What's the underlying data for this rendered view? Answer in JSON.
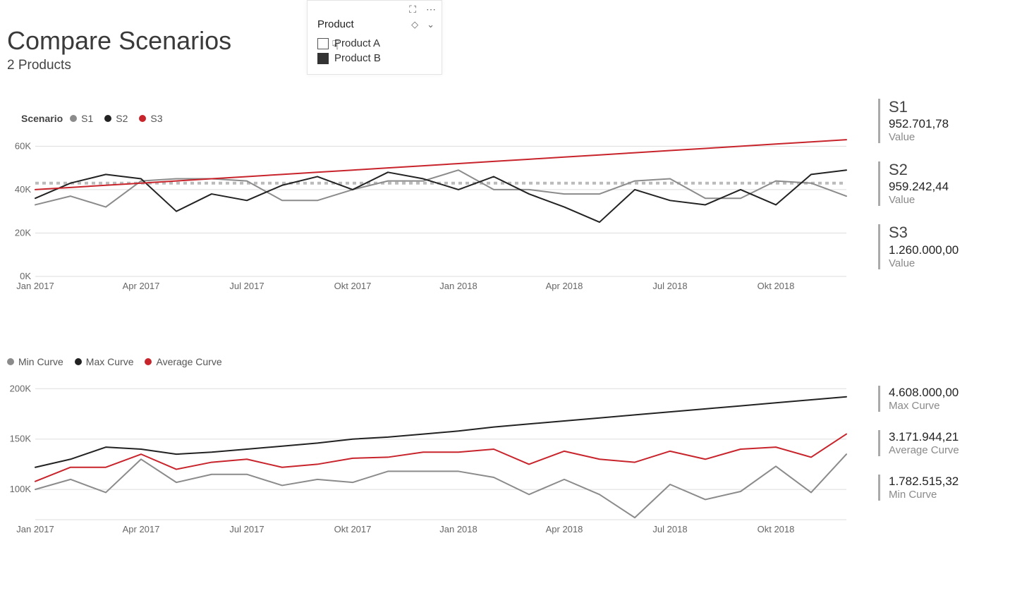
{
  "header": {
    "title": "Compare Scenarios",
    "subtitle": "2 Products"
  },
  "slicer": {
    "title": "Product",
    "items": [
      {
        "label": "Product A",
        "checked": false
      },
      {
        "label": "Product B",
        "checked": true
      }
    ],
    "icons": {
      "grip": "grip",
      "focus": "focus-mode-icon",
      "more": "⋯",
      "clear": "⌫",
      "dropdown": "⌄"
    }
  },
  "chart1": {
    "legend_label": "Scenario",
    "legend": [
      "S1",
      "S2",
      "S3"
    ],
    "xticks": [
      "Jan 2017",
      "Apr 2017",
      "Jul 2017",
      "Okt 2017",
      "Jan 2018",
      "Apr 2018",
      "Jul 2018",
      "Okt 2018"
    ],
    "yticks": [
      "0K",
      "20K",
      "40K",
      "60K"
    ],
    "ymin": 0,
    "ymax": 65,
    "avg_line": 43
  },
  "kpis1": [
    {
      "title": "S1",
      "value": "952.701,78",
      "sub": "Value"
    },
    {
      "title": "S2",
      "value": "959.242,44",
      "sub": "Value"
    },
    {
      "title": "S3",
      "value": "1.260.000,00",
      "sub": "Value"
    }
  ],
  "chart2": {
    "legend": [
      "Min Curve",
      "Max Curve",
      "Average Curve"
    ],
    "xticks": [
      "Jan 2017",
      "Apr 2017",
      "Jul 2017",
      "Okt 2017",
      "Jan 2018",
      "Apr 2018",
      "Jul 2018",
      "Okt 2018"
    ],
    "yticks": [
      "100K",
      "150K",
      "200K"
    ],
    "ymin": 70,
    "ymax": 210
  },
  "kpis2": [
    {
      "title": "",
      "value": "4.608.000,00",
      "sub": "Max Curve"
    },
    {
      "title": "",
      "value": "3.171.944,21",
      "sub": "Average Curve"
    },
    {
      "title": "",
      "value": "1.782.515,32",
      "sub": "Min Curve"
    }
  ],
  "chart_data": [
    {
      "type": "line",
      "title": "Scenario comparison",
      "xlabel": "",
      "ylabel": "",
      "ylim": [
        0,
        65000
      ],
      "average_reference": 43000,
      "x": [
        "2017-01",
        "2017-02",
        "2017-03",
        "2017-04",
        "2017-05",
        "2017-06",
        "2017-07",
        "2017-08",
        "2017-09",
        "2017-10",
        "2017-11",
        "2017-12",
        "2018-01",
        "2018-02",
        "2018-03",
        "2018-04",
        "2018-05",
        "2018-06",
        "2018-07",
        "2018-08",
        "2018-09",
        "2018-10",
        "2018-11",
        "2018-12"
      ],
      "series": [
        {
          "name": "S1",
          "color": "#8b8b8b",
          "values": [
            33000,
            37000,
            32000,
            44000,
            45000,
            45000,
            44000,
            35000,
            35000,
            40000,
            44000,
            44000,
            49000,
            40000,
            40000,
            38000,
            38000,
            44000,
            45000,
            36000,
            36000,
            44000,
            43000,
            37000
          ]
        },
        {
          "name": "S2",
          "color": "#222222",
          "values": [
            36000,
            43000,
            47000,
            45000,
            30000,
            38000,
            35000,
            42000,
            46000,
            40000,
            48000,
            45000,
            40000,
            46000,
            38000,
            32000,
            25000,
            40000,
            35000,
            33000,
            40000,
            33000,
            47000,
            49000
          ]
        },
        {
          "name": "S3",
          "color": "#c8242c",
          "values": [
            40000,
            41000,
            42000,
            43000,
            44000,
            45000,
            46000,
            47000,
            48000,
            49000,
            50000,
            51000,
            52000,
            53000,
            54000,
            55000,
            56000,
            57000,
            58000,
            59000,
            60000,
            61000,
            62000,
            63000
          ]
        }
      ]
    },
    {
      "type": "line",
      "title": "Min / Max / Average curves",
      "xlabel": "",
      "ylabel": "",
      "ylim": [
        70000,
        210000
      ],
      "x": [
        "2017-01",
        "2017-02",
        "2017-03",
        "2017-04",
        "2017-05",
        "2017-06",
        "2017-07",
        "2017-08",
        "2017-09",
        "2017-10",
        "2017-11",
        "2017-12",
        "2018-01",
        "2018-02",
        "2018-03",
        "2018-04",
        "2018-05",
        "2018-06",
        "2018-07",
        "2018-08",
        "2018-09",
        "2018-10",
        "2018-11",
        "2018-12"
      ],
      "series": [
        {
          "name": "Min Curve",
          "color": "#8b8b8b",
          "values": [
            100000,
            110000,
            97000,
            130000,
            107000,
            115000,
            115000,
            104000,
            110000,
            107000,
            118000,
            118000,
            118000,
            112000,
            95000,
            110000,
            95000,
            72000,
            105000,
            90000,
            98000,
            123000,
            97000,
            135000
          ]
        },
        {
          "name": "Max Curve",
          "color": "#222222",
          "values": [
            122000,
            130000,
            142000,
            140000,
            135000,
            137000,
            140000,
            143000,
            146000,
            150000,
            152000,
            155000,
            158000,
            162000,
            165000,
            168000,
            171000,
            174000,
            177000,
            180000,
            183000,
            186000,
            189000,
            192000
          ]
        },
        {
          "name": "Average Curve",
          "color": "#c8242c",
          "values": [
            108000,
            122000,
            122000,
            135000,
            120000,
            127000,
            130000,
            122000,
            125000,
            131000,
            132000,
            137000,
            137000,
            140000,
            125000,
            138000,
            130000,
            127000,
            138000,
            130000,
            140000,
            142000,
            132000,
            155000
          ]
        }
      ]
    }
  ]
}
